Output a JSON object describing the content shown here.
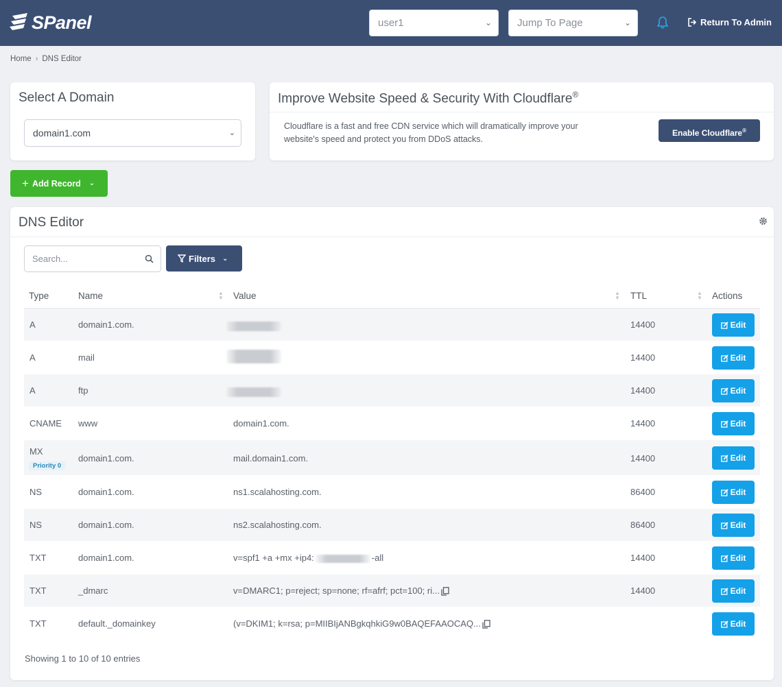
{
  "header": {
    "logo_text": "SPanel",
    "user_select": "user1",
    "jump_placeholder": "Jump To Page",
    "return_admin": "Return To Admin"
  },
  "breadcrumb": {
    "home": "Home",
    "current": "DNS Editor"
  },
  "domain_card": {
    "title": "Select A Domain",
    "selected": "domain1.com"
  },
  "cloudflare": {
    "title": "Improve Website Speed & Security With Cloudflare",
    "title_mark": "®",
    "description": "Cloudflare is a fast and free CDN service which will dramatically improve your website's speed and protect you from DDoS attacks.",
    "button": "Enable Cloudflare",
    "button_mark": "®"
  },
  "add_record": "Add Record",
  "dns": {
    "title": "DNS Editor",
    "search_placeholder": "Search...",
    "filters": "Filters",
    "columns": {
      "type": "Type",
      "name": "Name",
      "value": "Value",
      "ttl": "TTL",
      "actions": "Actions"
    },
    "edit_label": "Edit",
    "rows": [
      {
        "type": "A",
        "name": "domain1.com.",
        "value": "",
        "ttl": "14400"
      },
      {
        "type": "A",
        "name": "mail",
        "value": "",
        "ttl": "14400"
      },
      {
        "type": "A",
        "name": "ftp",
        "value": "",
        "ttl": "14400"
      },
      {
        "type": "CNAME",
        "name": "www",
        "value": "domain1.com.",
        "ttl": "14400"
      },
      {
        "type": "MX",
        "priority": "Priority 0",
        "name": "domain1.com.",
        "value": "mail.domain1.com.",
        "ttl": "14400"
      },
      {
        "type": "NS",
        "name": "domain1.com.",
        "value": "ns1.scalahosting.com.",
        "ttl": "86400"
      },
      {
        "type": "NS",
        "name": "domain1.com.",
        "value": "ns2.scalahosting.com.",
        "ttl": "86400"
      },
      {
        "type": "TXT",
        "name": "domain1.com.",
        "value_prefix": "v=spf1 +a +mx +ip4:",
        "value_suffix": "-all",
        "ttl": "14400"
      },
      {
        "type": "TXT",
        "name": "_dmarc",
        "value": "v=DMARC1; p=reject; sp=none; rf=afrf; pct=100; ri...",
        "ttl": "14400"
      },
      {
        "type": "TXT",
        "name": "default._domainkey",
        "value": "(v=DKIM1; k=rsa; p=MIIBIjANBgkqhkiG9w0BAQEFAAOCAQ...",
        "ttl": ""
      }
    ],
    "footer": "Showing 1 to 10 of 10 entries"
  },
  "colors": {
    "header": "#3b4f73",
    "green": "#3fb62e",
    "blue": "#14a1e8"
  }
}
